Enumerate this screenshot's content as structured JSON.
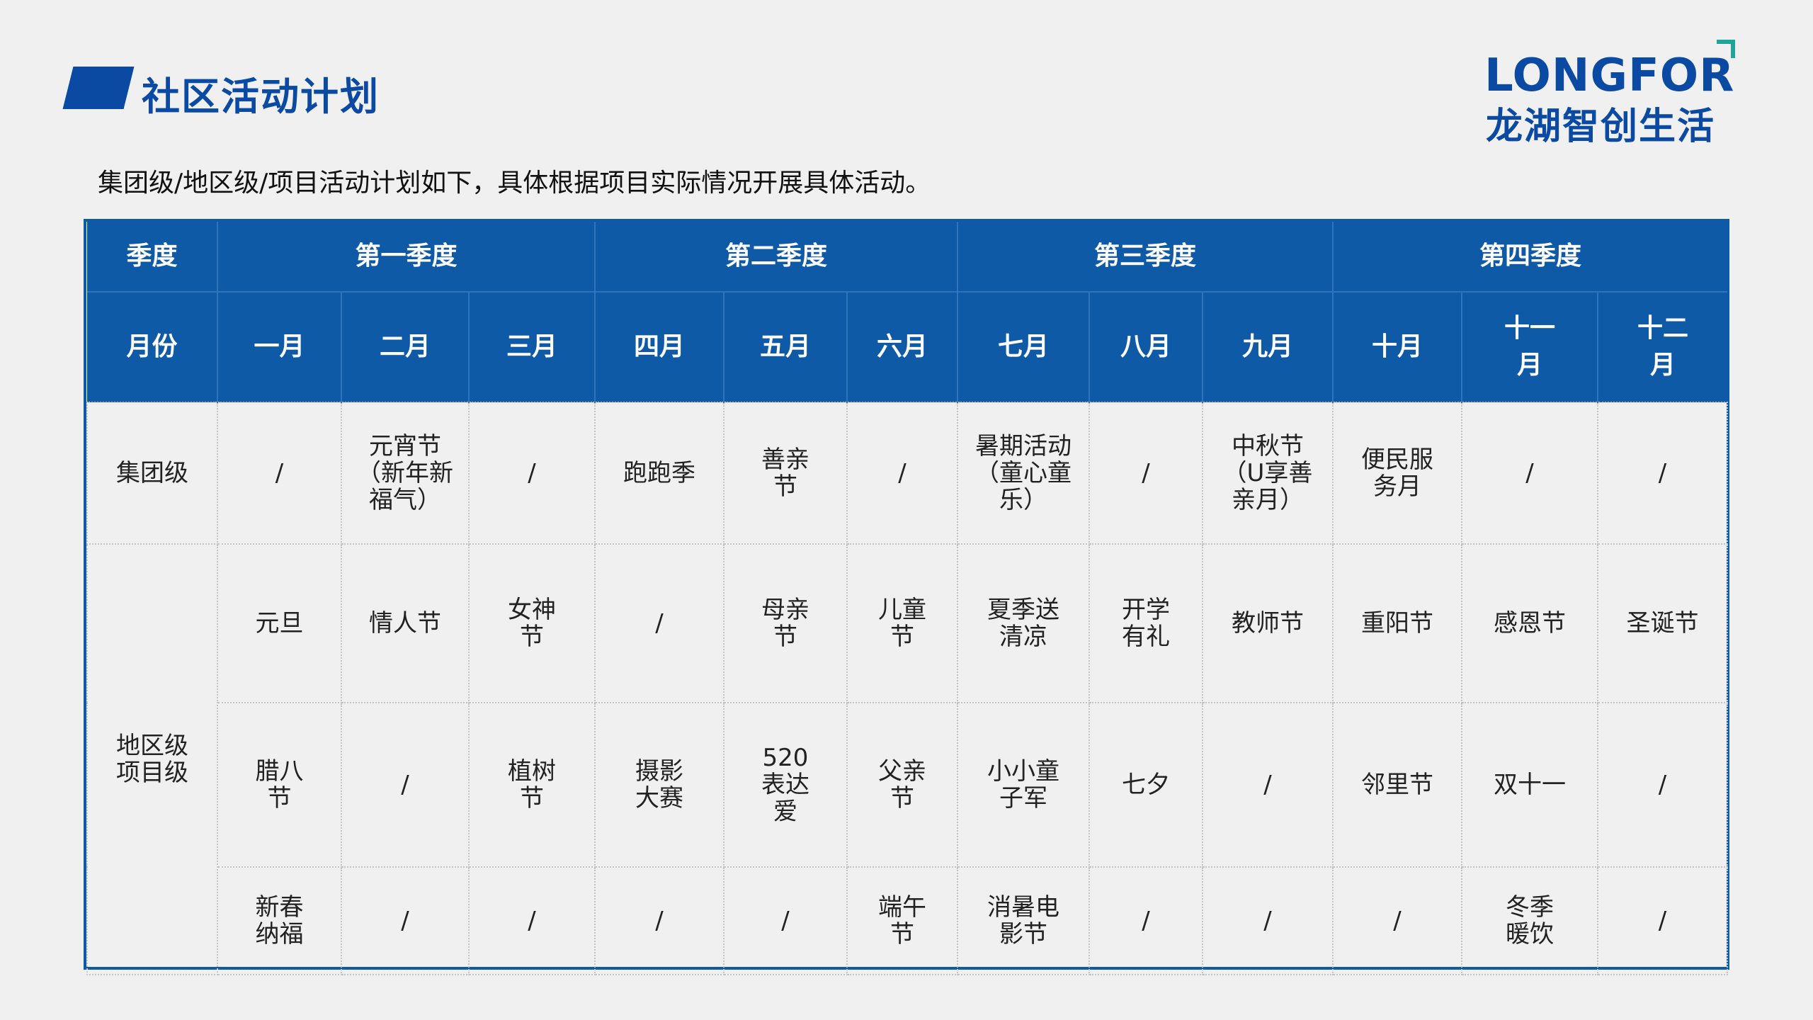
{
  "page": {
    "title": "社区活动计划",
    "subtitle": "集团级/地区级/项目活动计划如下，具体根据项目实际情况开展具体活动。"
  },
  "logo": {
    "en": "LONGFOR",
    "cn": "龙湖智创生活",
    "accent_color": "#22a39a"
  },
  "colors": {
    "primary": "#0b4aa2",
    "header_bg": "#0e5aa7",
    "page_bg": "#f0f0f0"
  },
  "table": {
    "quarter_header_label": "季度",
    "quarters": [
      "第一季度",
      "第二季度",
      "第三季度",
      "第四季度"
    ],
    "month_header_label": "月份",
    "months": [
      "一月",
      "二月",
      "三月",
      "四月",
      "五月",
      "六月",
      "七月",
      "八月",
      "九月",
      "十月",
      "十一月",
      "十二月"
    ],
    "group_row": {
      "label": "集团级",
      "cells": [
        "/",
        "元宵节（新年新福气）",
        "/",
        "跑跑季",
        "善亲节",
        "/",
        "暑期活动（童心童乐）",
        "/",
        "中秋节（U享善亲月）",
        "便民服务月",
        "/",
        "/"
      ]
    },
    "region_label": "地区级项目级",
    "region_rows": [
      [
        "元旦",
        "情人节",
        "女神节",
        "/",
        "母亲节",
        "儿童节",
        "夏季送清凉",
        "开学有礼",
        "教师节",
        "重阳节",
        "感恩节",
        "圣诞节"
      ],
      [
        "腊八节",
        "/",
        "植树节",
        "摄影大赛",
        "520表达爱",
        "父亲节",
        "小小童子军",
        "七夕",
        "/",
        "邻里节",
        "双十一",
        "/"
      ],
      [
        "新春纳福",
        "/",
        "/",
        "/",
        "/",
        "端午节",
        "消暑电影节",
        "/",
        "/",
        "/",
        "冬季暖饮",
        "/"
      ]
    ]
  }
}
